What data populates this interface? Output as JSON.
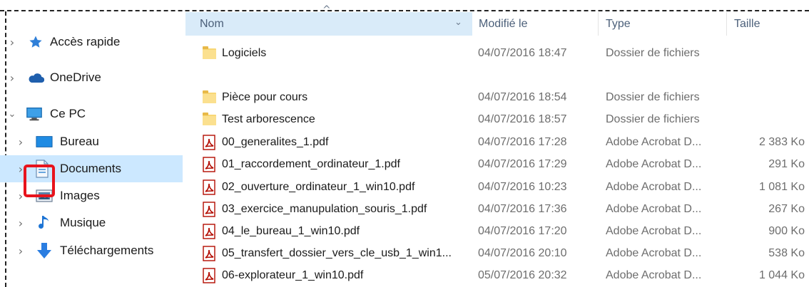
{
  "nav": {
    "items": [
      {
        "label": "Accès rapide",
        "icon": "star-icon",
        "expanded": false
      },
      {
        "label": "OneDrive",
        "icon": "cloud-icon",
        "expanded": false
      },
      {
        "label": "Ce PC",
        "icon": "computer-icon",
        "expanded": true
      },
      {
        "label": "Bureau",
        "icon": "desktop-icon",
        "expanded": false
      },
      {
        "label": "Documents",
        "icon": "documents-icon",
        "expanded": false,
        "selected": true
      },
      {
        "label": "Images",
        "icon": "images-icon",
        "expanded": false
      },
      {
        "label": "Musique",
        "icon": "music-icon",
        "expanded": false
      },
      {
        "label": "Téléchargements",
        "icon": "download-icon",
        "expanded": false
      }
    ]
  },
  "columns": {
    "name": "Nom",
    "modified": "Modifié le",
    "type": "Type",
    "size": "Taille"
  },
  "files": [
    {
      "name": "Logiciels",
      "modified": "04/07/2016 18:47",
      "type": "Dossier de fichiers",
      "size": "",
      "kind": "folder"
    },
    {
      "name": "Pièce pour cours",
      "modified": "04/07/2016 18:54",
      "type": "Dossier de fichiers",
      "size": "",
      "kind": "folder"
    },
    {
      "name": "Test arborescence",
      "modified": "04/07/2016 18:57",
      "type": "Dossier de fichiers",
      "size": "",
      "kind": "folder"
    },
    {
      "name": "00_generalites_1.pdf",
      "modified": "04/07/2016 17:28",
      "type": "Adobe Acrobat D...",
      "size": "2 383 Ko",
      "kind": "pdf"
    },
    {
      "name": "01_raccordement_ordinateur_1.pdf",
      "modified": "04/07/2016 17:29",
      "type": "Adobe Acrobat D...",
      "size": "291 Ko",
      "kind": "pdf"
    },
    {
      "name": "02_ouverture_ordinateur_1_win10.pdf",
      "modified": "04/07/2016 10:23",
      "type": "Adobe Acrobat D...",
      "size": "1 081 Ko",
      "kind": "pdf"
    },
    {
      "name": "03_exercice_manupulation_souris_1.pdf",
      "modified": "04/07/2016 17:36",
      "type": "Adobe Acrobat D...",
      "size": "267 Ko",
      "kind": "pdf"
    },
    {
      "name": "04_le_bureau_1_win10.pdf",
      "modified": "04/07/2016 17:20",
      "type": "Adobe Acrobat D...",
      "size": "900 Ko",
      "kind": "pdf"
    },
    {
      "name": "05_transfert_dossier_vers_cle_usb_1_win1...",
      "modified": "04/07/2016 20:10",
      "type": "Adobe Acrobat D...",
      "size": "538 Ko",
      "kind": "pdf"
    },
    {
      "name": "06-explorateur_1_win10.pdf",
      "modified": "05/07/2016 20:32",
      "type": "Adobe Acrobat D...",
      "size": "1 044 Ko",
      "kind": "pdf"
    }
  ],
  "colors": {
    "selection": "#cce8ff",
    "header_sorted": "#d9ebf9",
    "highlight_box": "#e8131c",
    "folder": "#f8d775",
    "pdf": "#b30b00"
  }
}
